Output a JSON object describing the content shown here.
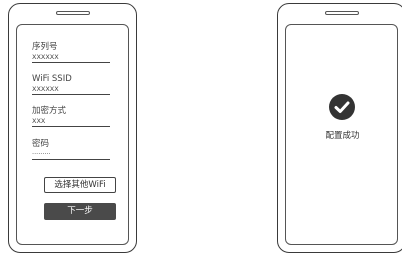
{
  "left_phone": {
    "fields": [
      {
        "label": "序列号",
        "value": "XXXXXX"
      },
      {
        "label": "WiFi SSID",
        "value": "XXXXXX"
      },
      {
        "label": "加密方式",
        "value": "XXX"
      },
      {
        "label": "密码",
        "value": "·········"
      }
    ],
    "select_wifi_button": "选择其他WiFi",
    "next_button": "下一步"
  },
  "right_phone": {
    "success_icon": "check-circle-icon",
    "success_text": "配置成功"
  },
  "colors": {
    "outline": "#3a3a3a",
    "button_fill": "#4a4a4a",
    "success_icon": "#333333"
  }
}
